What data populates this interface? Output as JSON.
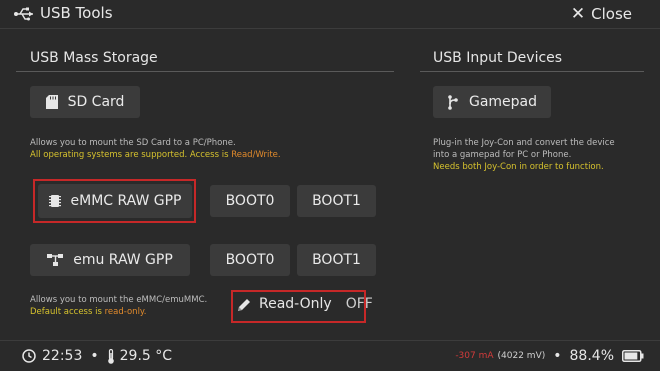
{
  "header": {
    "title": "USB Tools",
    "close_label": "Close"
  },
  "mass_storage": {
    "title": "USB Mass Storage",
    "sd_card_label": "SD Card",
    "sd_desc_line1": "Allows you to mount the SD Card to a PC/Phone.",
    "sd_desc_line2_a": "All operating systems are supported. Access is ",
    "sd_desc_line2_b": "Read/Write.",
    "emmc_label": "eMMC RAW GPP",
    "emmc_boot0": "BOOT0",
    "emmc_boot1": "BOOT1",
    "emu_label": "emu RAW GPP",
    "emu_boot0": "BOOT0",
    "emu_boot1": "BOOT1",
    "emmc_desc_line1": "Allows you to mount the eMMC/emuMMC.",
    "emmc_desc_line2_a": "Default access is ",
    "emmc_desc_line2_b": "read-only.",
    "readonly_label": "Read-Only",
    "readonly_value": "OFF"
  },
  "input_devices": {
    "title": "USB Input Devices",
    "gamepad_label": "Gamepad",
    "desc_line1": "Plug-in the Joy-Con and convert the device",
    "desc_line2": "into a gamepad for PC or Phone.",
    "desc_line3": "Needs both Joy-Con in order to function."
  },
  "status": {
    "time": "22:53",
    "temperature": "29.5 °C",
    "current": "-307 mA",
    "voltage": "(4022 mV)",
    "battery": "88.4%",
    "battery_level": 0.884
  },
  "colors": {
    "highlight": "#c62828",
    "yellow": "#d6c22e",
    "orange": "#e08a2c",
    "red": "#d23b3b"
  }
}
